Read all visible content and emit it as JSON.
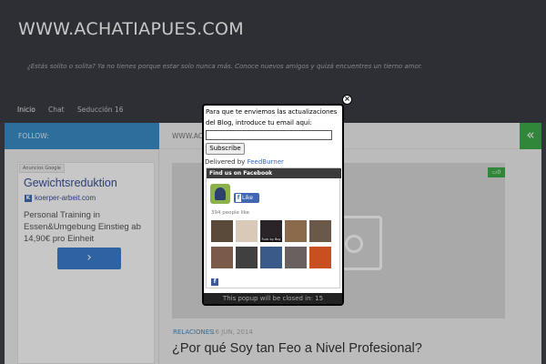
{
  "header": {
    "site_title": "WWW.ACHATIAPUES.COM",
    "tagline": "¿Estás solito o solita? Ya no tienes porque estar solo nunca más. Conoce nuevos amigos y quizá encuentres un tierno amor."
  },
  "nav": {
    "items": [
      {
        "label": "Inicio",
        "active": true
      },
      {
        "label": "Chat",
        "active": false
      },
      {
        "label": "Seducción 16",
        "active": false
      }
    ]
  },
  "follow_label": "FOLLOW:",
  "content_bar_text": "WWW.AC",
  "collapse_icon": "double-chevron-left-icon",
  "ad": {
    "by_label": "Anuncios Google",
    "title": "Gewichtsreduktion",
    "url": "koerper-arbeit.com",
    "body": "Personal Training in Essen&Umgebung Einstieg ab 14,90€ pro Einheit",
    "button_icon": "chevron-right-icon"
  },
  "article": {
    "comment_count": "0",
    "category": "RELACIONES",
    "date": "16 JUN, 2014",
    "title": "¿Por qué Soy tan Feo a Nivel Profesional?",
    "thumbnail_icon": "camera-icon"
  },
  "popup": {
    "close_icon": "close-icon",
    "intro_text": "Para que te enviemos las actualizaciones del Blog, introduce tu email aquí:",
    "email_value": "",
    "subscribe_label": "Subscribe",
    "delivered_by": "Delivered by",
    "delivered_service": "FeedBurner",
    "footer_text": "This popup will be closed in: 15"
  },
  "facebook": {
    "header": "Find us on Facebook",
    "like_label": "Like",
    "count_text": "394 people like",
    "faces": [
      {
        "name": "",
        "color": "#5a4a3a"
      },
      {
        "name": "",
        "color": "#d9c9b8"
      },
      {
        "name": "Fuck by Boy",
        "color": "#2a2428"
      },
      {
        "name": "",
        "color": "#8a6a4a"
      },
      {
        "name": "",
        "color": "#6a5848"
      },
      {
        "name": "",
        "color": "#7a5a48"
      },
      {
        "name": "",
        "color": "#404040"
      },
      {
        "name": "",
        "color": "#3a5a8a"
      },
      {
        "name": "",
        "color": "#6a6060"
      },
      {
        "name": "",
        "color": "#c85020"
      }
    ]
  },
  "colors": {
    "header_bg": "#3a3d43",
    "follow_blue": "#3a8dca",
    "accent_green": "#3fae49"
  }
}
